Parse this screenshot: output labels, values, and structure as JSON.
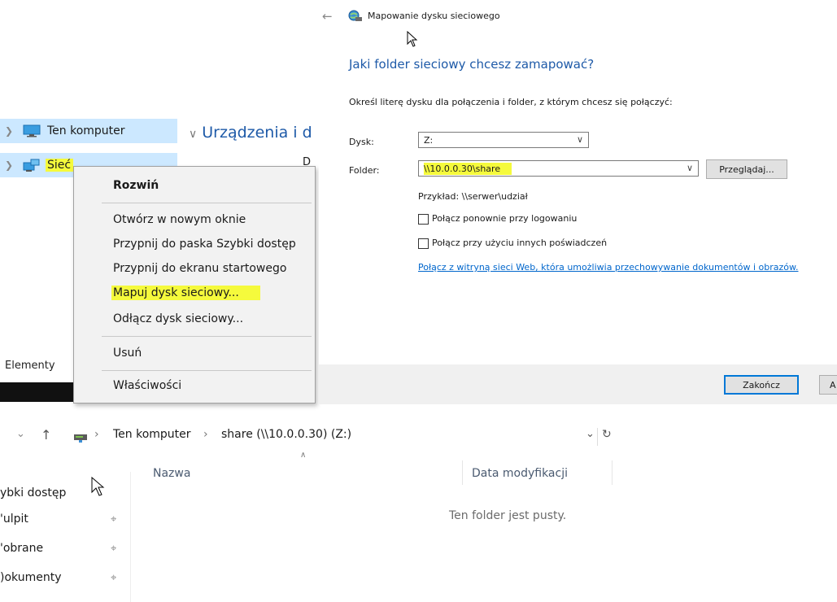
{
  "nav": {
    "items": [
      {
        "label": "Ten komputer"
      },
      {
        "label": "Sieć"
      }
    ],
    "group_header": "Urządzenia i d",
    "column_fragment": "D",
    "elements_label": "Elementy"
  },
  "context_menu": {
    "items": [
      {
        "label": "Rozwiń"
      },
      {
        "label": "Otwórz w nowym oknie"
      },
      {
        "label": "Przypnij do paska Szybki dostęp"
      },
      {
        "label": "Przypnij do ekranu startowego"
      },
      {
        "label": "Mapuj dysk sieciowy..."
      },
      {
        "label": "Odłącz dysk sieciowy..."
      },
      {
        "label": "Usuń"
      },
      {
        "label": "Właściwości"
      }
    ]
  },
  "dialog": {
    "back_symbol": "←",
    "window_title": "Mapowanie dysku sieciowego",
    "heading": "Jaki folder sieciowy chcesz zamapować?",
    "instruction": "Określ literę dysku dla połączenia i folder, z którym chcesz się połączyć:",
    "drive_label": "Dysk:",
    "drive_value": "Z:",
    "folder_label": "Folder:",
    "folder_value": "\\\\10.0.0.30\\share",
    "browse_label": "Przeglądaj...",
    "example_text": "Przykład: \\\\serwer\\udział",
    "reconnect_label": "Połącz ponownie przy logowaniu",
    "reconnect_checked": false,
    "other_credentials_label": "Połącz przy użyciu innych poświadczeń",
    "other_credentials_checked": false,
    "link_text": "Połącz z witryną sieci Web, która umożliwia przechowywanie dokumentów i obrazów.",
    "finish_label": "Zakończ",
    "cancel_fragment": "A"
  },
  "explorer": {
    "address": {
      "down_symbol": "⌄",
      "up_symbol": "↑",
      "separator": "›",
      "crumb_computer": "Ten komputer",
      "crumb_share": "share (\\\\10.0.0.30) (Z:)",
      "dropdown_symbol": "⌄",
      "refresh_symbol": "↻"
    },
    "quick_access": [
      {
        "label": "ybki dostęp",
        "pinned": false
      },
      {
        "label": "'ulpit",
        "pinned": true
      },
      {
        "label": "'obrane",
        "pinned": true
      },
      {
        "label": ")okumenty",
        "pinned": true
      }
    ],
    "col_name": "Nazwa",
    "col_date": "Data modyfikacji",
    "empty_message": "Ten folder jest pusty."
  },
  "colors": {
    "highlight": "#f5fa3c",
    "link_blue": "#0066cc",
    "heading_blue": "#1e5aa8",
    "selection_blue": "#cce8ff",
    "focus_button_border": "#0078d7"
  }
}
